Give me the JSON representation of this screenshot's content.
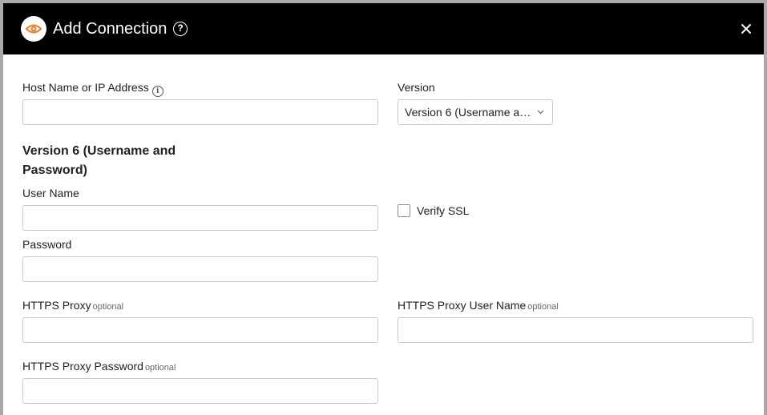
{
  "header": {
    "title": "Add Connection",
    "help_glyph": "?",
    "logo_icon": "eye-icon",
    "accent_color": "#f07b22"
  },
  "form": {
    "host": {
      "label": "Host Name or IP Address",
      "info_glyph": "i",
      "value": "",
      "placeholder": ""
    },
    "version": {
      "label": "Version",
      "selected": "Version 6 (Username and Password)"
    },
    "section_heading": "Version 6 (Username and Password)",
    "username": {
      "label": "User Name",
      "value": ""
    },
    "password": {
      "label": "Password",
      "value": ""
    },
    "verify_ssl": {
      "label": "Verify SSL",
      "checked": false
    },
    "https_proxy": {
      "label": "HTTPS Proxy",
      "optional": "optional",
      "value": ""
    },
    "https_proxy_user": {
      "label": "HTTPS Proxy User Name",
      "optional": "optional",
      "value": ""
    },
    "https_proxy_password": {
      "label": "HTTPS Proxy Password",
      "optional": "optional",
      "value": ""
    }
  }
}
